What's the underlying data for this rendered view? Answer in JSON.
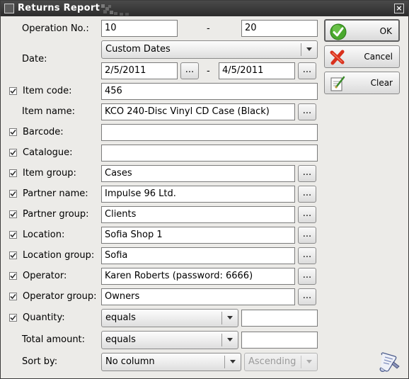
{
  "window": {
    "title": "Returns Report",
    "close_glyph": "×"
  },
  "operation_no": {
    "label": "Operation No.:",
    "from": "10",
    "to": "20"
  },
  "date": {
    "label": "Date:",
    "mode": "Custom Dates",
    "from": "2/5/2011",
    "to": "4/5/2011"
  },
  "range_separator": "-",
  "browse_label": "...",
  "filters": {
    "item_code": {
      "label": "Item code:",
      "value": "456",
      "checked": true
    },
    "item_name": {
      "label": "Item name:",
      "value": "KCO 240-Disc Vinyl CD Case (Black)"
    },
    "barcode": {
      "label": "Barcode:",
      "value": "",
      "checked": true
    },
    "catalogue": {
      "label": "Catalogue:",
      "value": "",
      "checked": true
    },
    "item_group": {
      "label": "Item group:",
      "value": "Cases",
      "checked": true
    },
    "partner_name": {
      "label": "Partner name:",
      "value": "Impulse 96 Ltd.",
      "checked": true
    },
    "partner_group": {
      "label": "Partner group:",
      "value": "Clients",
      "checked": true
    },
    "location": {
      "label": "Location:",
      "value": "Sofia Shop 1",
      "checked": true
    },
    "location_group": {
      "label": "Location group:",
      "value": "Sofia",
      "checked": true
    },
    "operator": {
      "label": "Operator:",
      "value": "Karen Roberts (password: 6666)",
      "checked": true
    },
    "operator_group": {
      "label": "Operator group:",
      "value": "Owners",
      "checked": true
    },
    "quantity": {
      "label": "Quantity:",
      "operator": "equals",
      "value": "",
      "checked": true
    },
    "total_amount": {
      "label": "Total amount:",
      "operator": "equals",
      "value": ""
    }
  },
  "sort": {
    "label": "Sort by:",
    "column": "No column",
    "direction": "Ascending"
  },
  "buttons": {
    "ok": "OK",
    "cancel": "Cancel",
    "clear": "Clear"
  },
  "colors": {
    "titlebar": "#2c2c2c",
    "window_bg": "#ecebe8",
    "ok_green": "#4aa82e",
    "cancel_red": "#d9301c"
  },
  "icons": [
    "check-icon",
    "cross-icon",
    "clear-icon",
    "scroll-icon"
  ]
}
